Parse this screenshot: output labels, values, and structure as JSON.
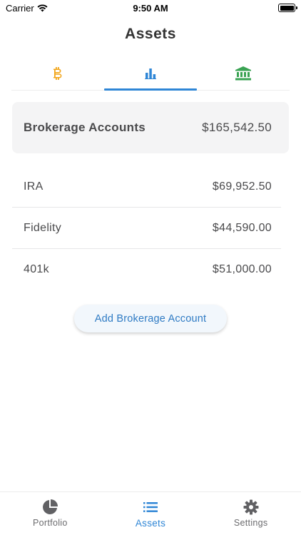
{
  "status_bar": {
    "carrier": "Carrier",
    "time": "9:50 AM"
  },
  "header": {
    "title": "Assets"
  },
  "top_tabs": [
    {
      "icon": "bitcoin-icon",
      "color": "#f2a51a",
      "active": false
    },
    {
      "icon": "bar-chart-icon",
      "color": "#2f86d6",
      "active": true
    },
    {
      "icon": "bank-icon",
      "color": "#3aa353",
      "active": false
    }
  ],
  "summary": {
    "label": "Brokerage Accounts",
    "value": "$165,542.50"
  },
  "accounts": [
    {
      "name": "IRA",
      "value": "$69,952.50"
    },
    {
      "name": "Fidelity",
      "value": "$44,590.00"
    },
    {
      "name": "401k",
      "value": "$51,000.00"
    }
  ],
  "add_button": {
    "label": "Add Brokerage Account"
  },
  "bottom_tabs": [
    {
      "label": "Portfolio",
      "icon": "pie-chart-icon",
      "active": false
    },
    {
      "label": "Assets",
      "icon": "list-icon",
      "active": true
    },
    {
      "label": "Settings",
      "icon": "gear-icon",
      "active": false
    }
  ],
  "colors": {
    "accent": "#2f86d6",
    "bitcoin": "#f2a51a",
    "bank": "#3aa353"
  }
}
